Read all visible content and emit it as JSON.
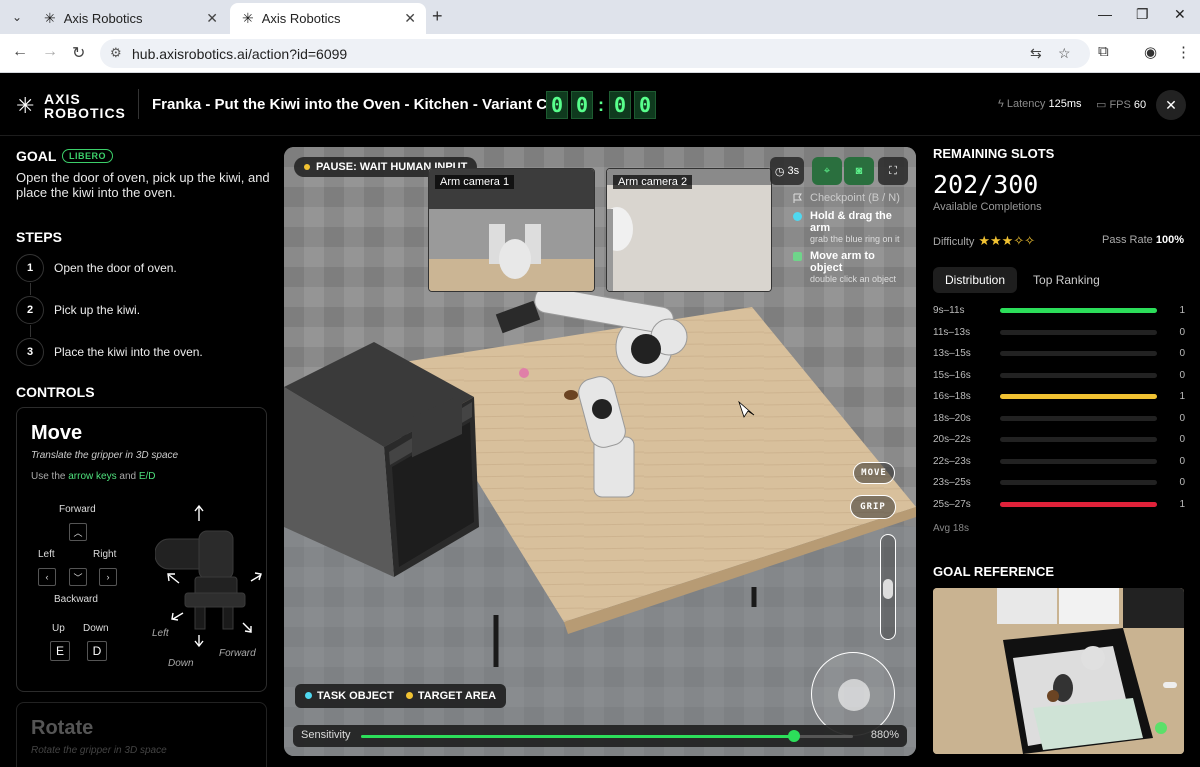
{
  "browser": {
    "tabs": [
      {
        "title": "Axis Robotics"
      },
      {
        "title": "Axis Robotics"
      }
    ],
    "url": "hub.axisrobotics.ai/action?id=6099"
  },
  "header": {
    "logo_line1": "AXIS",
    "logo_line2": "ROBOTICS",
    "task_title": "Franka - Put the Kiwi into the Oven - Kitchen - Variant C",
    "timer": [
      "0",
      "0",
      "0",
      "0"
    ],
    "latency_label": "Latency",
    "latency_value": "125ms",
    "fps_label": "FPS",
    "fps_value": "60"
  },
  "left": {
    "goal_heading": "GOAL",
    "goal_badge": "LIBERO",
    "goal_text": "Open the door of oven, pick up the kiwi, and place the kiwi into the oven.",
    "steps_heading": "STEPS",
    "steps": [
      {
        "num": "1",
        "text": "Open the door of oven."
      },
      {
        "num": "2",
        "text": "Pick up the kiwi."
      },
      {
        "num": "3",
        "text": "Place the kiwi into the oven."
      }
    ],
    "controls_heading": "CONTROLS",
    "move": {
      "title": "Move",
      "subtitle": "Translate the gripper in 3D space",
      "hint_prefix": "Use the ",
      "hint_keys": "arrow keys",
      "hint_and": " and ",
      "hint_ed": "E/D",
      "forward": "Forward",
      "left": "Left",
      "right": "Right",
      "backward": "Backward",
      "up": "Up",
      "down": "Down",
      "key_e": "E",
      "key_d": "D",
      "fig_left": "Left",
      "fig_down": "Down",
      "fig_forward": "Forward"
    },
    "rotate": {
      "title": "Rotate",
      "subtitle": "Rotate the gripper in 3D space"
    }
  },
  "viewport": {
    "pause_text": "PAUSE: WAIT HUMAN INPUT",
    "cam1_label": "Arm camera 1",
    "cam2_label": "Arm camera 2",
    "timer_btn": "3s",
    "hints": [
      {
        "title": "Checkpoint (B / N)",
        "sub": ""
      },
      {
        "title": "Hold & drag the arm",
        "sub": "grab the blue ring on it"
      },
      {
        "title": "Move arm to object",
        "sub": "double click an object"
      }
    ],
    "legend_task": "TASK OBJECT",
    "legend_target": "TARGET AREA",
    "sensitivity_label": "Sensitivity",
    "sensitivity_value": "880%",
    "sensitivity_fraction": 0.88,
    "move_btn": "MOVE",
    "grip_btn": "GRIP",
    "colors": {
      "task": "#4fd8f0",
      "target": "#f1c232",
      "accent": "#2cde5a"
    }
  },
  "right": {
    "slots_heading": "REMAINING SLOTS",
    "slots_value": "202/300",
    "slots_sub": "Available Completions",
    "difficulty_label": "Difficulty",
    "difficulty_stars": "★★★✧✧",
    "pass_rate_label": "Pass Rate",
    "pass_rate_value": "100%",
    "tabs": [
      "Distribution",
      "Top Ranking"
    ],
    "histogram": [
      {
        "label": "9s–11s",
        "count": "1",
        "color": "#2cde5a"
      },
      {
        "label": "11s–13s",
        "count": "0",
        "color": ""
      },
      {
        "label": "13s–15s",
        "count": "0",
        "color": ""
      },
      {
        "label": "15s–16s",
        "count": "0",
        "color": ""
      },
      {
        "label": "16s–18s",
        "count": "1",
        "color": "#f1c232"
      },
      {
        "label": "18s–20s",
        "count": "0",
        "color": ""
      },
      {
        "label": "20s–22s",
        "count": "0",
        "color": ""
      },
      {
        "label": "22s–23s",
        "count": "0",
        "color": ""
      },
      {
        "label": "23s–25s",
        "count": "0",
        "color": ""
      },
      {
        "label": "25s–27s",
        "count": "1",
        "color": "#e0223a"
      }
    ],
    "avg": "Avg 18s",
    "goal_ref_heading": "GOAL REFERENCE"
  }
}
